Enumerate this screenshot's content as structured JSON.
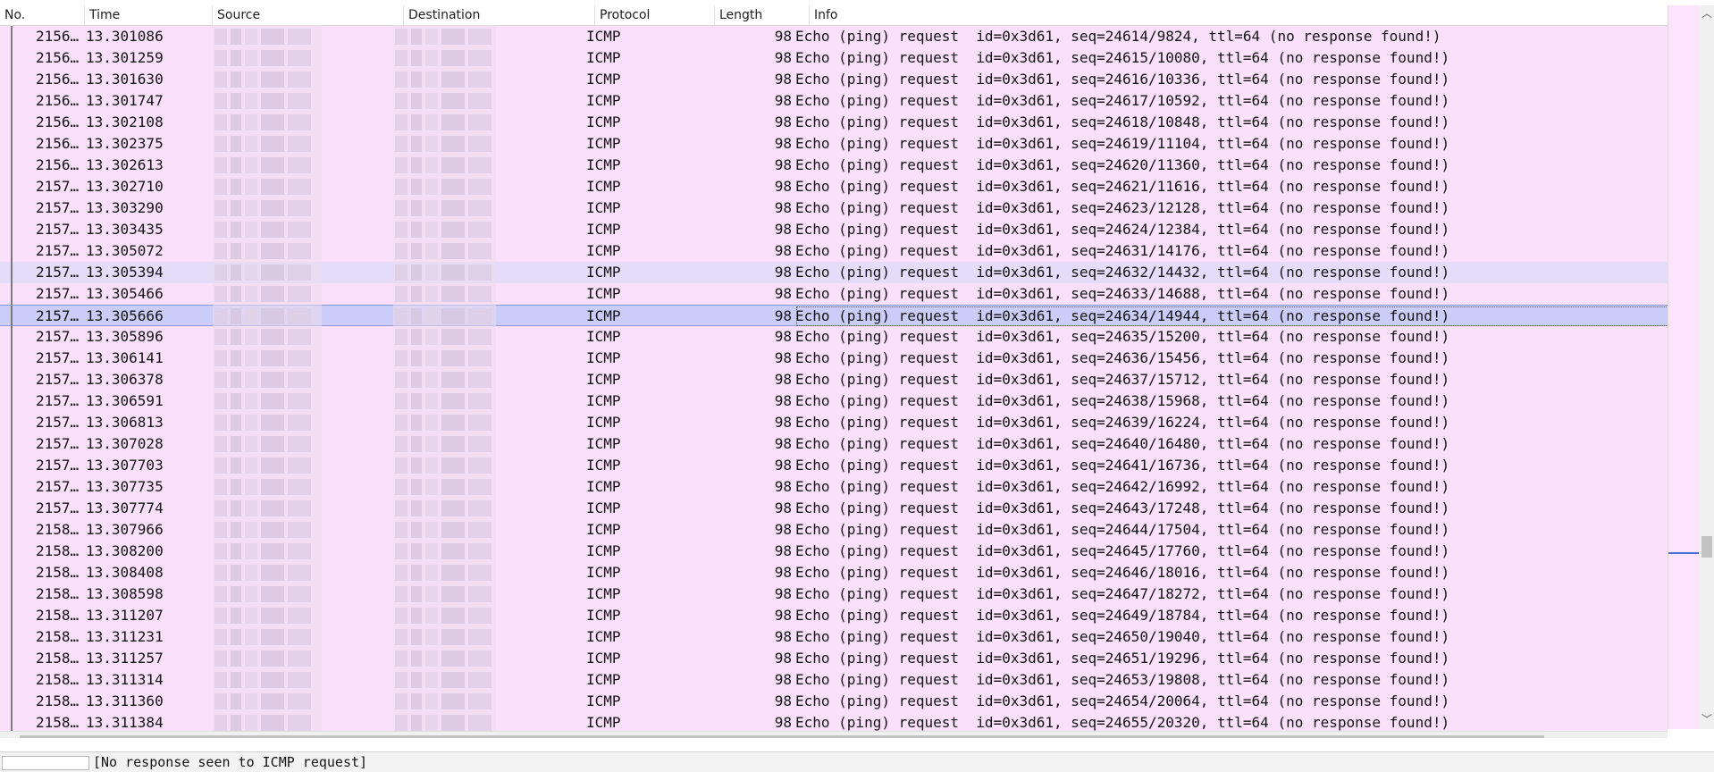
{
  "columns": {
    "no": "No.",
    "time": "Time",
    "source": "Source",
    "destination": "Destination",
    "protocol": "Protocol",
    "length": "Length",
    "info": "Info"
  },
  "packets": [
    {
      "no": "2156…",
      "time": "13.301086",
      "protocol": "ICMP",
      "length": "98",
      "info": "Echo (ping) request  id=0x3d61, seq=24614/9824, ttl=64 (no response found!)"
    },
    {
      "no": "2156…",
      "time": "13.301259",
      "protocol": "ICMP",
      "length": "98",
      "info": "Echo (ping) request  id=0x3d61, seq=24615/10080, ttl=64 (no response found!)"
    },
    {
      "no": "2156…",
      "time": "13.301630",
      "protocol": "ICMP",
      "length": "98",
      "info": "Echo (ping) request  id=0x3d61, seq=24616/10336, ttl=64 (no response found!)"
    },
    {
      "no": "2156…",
      "time": "13.301747",
      "protocol": "ICMP",
      "length": "98",
      "info": "Echo (ping) request  id=0x3d61, seq=24617/10592, ttl=64 (no response found!)"
    },
    {
      "no": "2156…",
      "time": "13.302108",
      "protocol": "ICMP",
      "length": "98",
      "info": "Echo (ping) request  id=0x3d61, seq=24618/10848, ttl=64 (no response found!)"
    },
    {
      "no": "2156…",
      "time": "13.302375",
      "protocol": "ICMP",
      "length": "98",
      "info": "Echo (ping) request  id=0x3d61, seq=24619/11104, ttl=64 (no response found!)"
    },
    {
      "no": "2156…",
      "time": "13.302613",
      "protocol": "ICMP",
      "length": "98",
      "info": "Echo (ping) request  id=0x3d61, seq=24620/11360, ttl=64 (no response found!)"
    },
    {
      "no": "2157…",
      "time": "13.302710",
      "protocol": "ICMP",
      "length": "98",
      "info": "Echo (ping) request  id=0x3d61, seq=24621/11616, ttl=64 (no response found!)"
    },
    {
      "no": "2157…",
      "time": "13.303290",
      "protocol": "ICMP",
      "length": "98",
      "info": "Echo (ping) request  id=0x3d61, seq=24623/12128, ttl=64 (no response found!)"
    },
    {
      "no": "2157…",
      "time": "13.303435",
      "protocol": "ICMP",
      "length": "98",
      "info": "Echo (ping) request  id=0x3d61, seq=24624/12384, ttl=64 (no response found!)"
    },
    {
      "no": "2157…",
      "time": "13.305072",
      "protocol": "ICMP",
      "length": "98",
      "info": "Echo (ping) request  id=0x3d61, seq=24631/14176, ttl=64 (no response found!)"
    },
    {
      "no": "2157…",
      "time": "13.305394",
      "protocol": "ICMP",
      "length": "98",
      "info": "Echo (ping) request  id=0x3d61, seq=24632/14432, ttl=64 (no response found!)",
      "state": "hover"
    },
    {
      "no": "2157…",
      "time": "13.305466",
      "protocol": "ICMP",
      "length": "98",
      "info": "Echo (ping) request  id=0x3d61, seq=24633/14688, ttl=64 (no response found!)"
    },
    {
      "no": "2157…",
      "time": "13.305666",
      "protocol": "ICMP",
      "length": "98",
      "info": "Echo (ping) request  id=0x3d61, seq=24634/14944, ttl=64 (no response found!)",
      "state": "selected"
    },
    {
      "no": "2157…",
      "time": "13.305896",
      "protocol": "ICMP",
      "length": "98",
      "info": "Echo (ping) request  id=0x3d61, seq=24635/15200, ttl=64 (no response found!)"
    },
    {
      "no": "2157…",
      "time": "13.306141",
      "protocol": "ICMP",
      "length": "98",
      "info": "Echo (ping) request  id=0x3d61, seq=24636/15456, ttl=64 (no response found!)"
    },
    {
      "no": "2157…",
      "time": "13.306378",
      "protocol": "ICMP",
      "length": "98",
      "info": "Echo (ping) request  id=0x3d61, seq=24637/15712, ttl=64 (no response found!)"
    },
    {
      "no": "2157…",
      "time": "13.306591",
      "protocol": "ICMP",
      "length": "98",
      "info": "Echo (ping) request  id=0x3d61, seq=24638/15968, ttl=64 (no response found!)"
    },
    {
      "no": "2157…",
      "time": "13.306813",
      "protocol": "ICMP",
      "length": "98",
      "info": "Echo (ping) request  id=0x3d61, seq=24639/16224, ttl=64 (no response found!)"
    },
    {
      "no": "2157…",
      "time": "13.307028",
      "protocol": "ICMP",
      "length": "98",
      "info": "Echo (ping) request  id=0x3d61, seq=24640/16480, ttl=64 (no response found!)"
    },
    {
      "no": "2157…",
      "time": "13.307703",
      "protocol": "ICMP",
      "length": "98",
      "info": "Echo (ping) request  id=0x3d61, seq=24641/16736, ttl=64 (no response found!)"
    },
    {
      "no": "2157…",
      "time": "13.307735",
      "protocol": "ICMP",
      "length": "98",
      "info": "Echo (ping) request  id=0x3d61, seq=24642/16992, ttl=64 (no response found!)"
    },
    {
      "no": "2157…",
      "time": "13.307774",
      "protocol": "ICMP",
      "length": "98",
      "info": "Echo (ping) request  id=0x3d61, seq=24643/17248, ttl=64 (no response found!)"
    },
    {
      "no": "2158…",
      "time": "13.307966",
      "protocol": "ICMP",
      "length": "98",
      "info": "Echo (ping) request  id=0x3d61, seq=24644/17504, ttl=64 (no response found!)"
    },
    {
      "no": "2158…",
      "time": "13.308200",
      "protocol": "ICMP",
      "length": "98",
      "info": "Echo (ping) request  id=0x3d61, seq=24645/17760, ttl=64 (no response found!)"
    },
    {
      "no": "2158…",
      "time": "13.308408",
      "protocol": "ICMP",
      "length": "98",
      "info": "Echo (ping) request  id=0x3d61, seq=24646/18016, ttl=64 (no response found!)"
    },
    {
      "no": "2158…",
      "time": "13.308598",
      "protocol": "ICMP",
      "length": "98",
      "info": "Echo (ping) request  id=0x3d61, seq=24647/18272, ttl=64 (no response found!)"
    },
    {
      "no": "2158…",
      "time": "13.311207",
      "protocol": "ICMP",
      "length": "98",
      "info": "Echo (ping) request  id=0x3d61, seq=24649/18784, ttl=64 (no response found!)"
    },
    {
      "no": "2158…",
      "time": "13.311231",
      "protocol": "ICMP",
      "length": "98",
      "info": "Echo (ping) request  id=0x3d61, seq=24650/19040, ttl=64 (no response found!)"
    },
    {
      "no": "2158…",
      "time": "13.311257",
      "protocol": "ICMP",
      "length": "98",
      "info": "Echo (ping) request  id=0x3d61, seq=24651/19296, ttl=64 (no response found!)"
    },
    {
      "no": "2158…",
      "time": "13.311314",
      "protocol": "ICMP",
      "length": "98",
      "info": "Echo (ping) request  id=0x3d61, seq=24653/19808, ttl=64 (no response found!)"
    },
    {
      "no": "2158…",
      "time": "13.311360",
      "protocol": "ICMP",
      "length": "98",
      "info": "Echo (ping) request  id=0x3d61, seq=24654/20064, ttl=64 (no response found!)"
    },
    {
      "no": "2158…",
      "time": "13.311384",
      "protocol": "ICMP",
      "length": "98",
      "info": "Echo (ping) request  id=0x3d61, seq=24655/20320, ttl=64 (no response found!)"
    }
  ],
  "status_bar": {
    "expert_info": "[No response seen to ICMP request]"
  },
  "colors": {
    "row_background": "#fae0fb",
    "hover_row": "#e4dcf8",
    "selected_row": "#c9cdf7",
    "minimap_marker": "#4b6fd6"
  },
  "icons": {
    "scroll_up": "scroll-up-arrow-icon",
    "scroll_down": "scroll-down-arrow-icon",
    "scroll_left": "scroll-left-arrow-icon",
    "scroll_right": "scroll-right-arrow-icon"
  }
}
